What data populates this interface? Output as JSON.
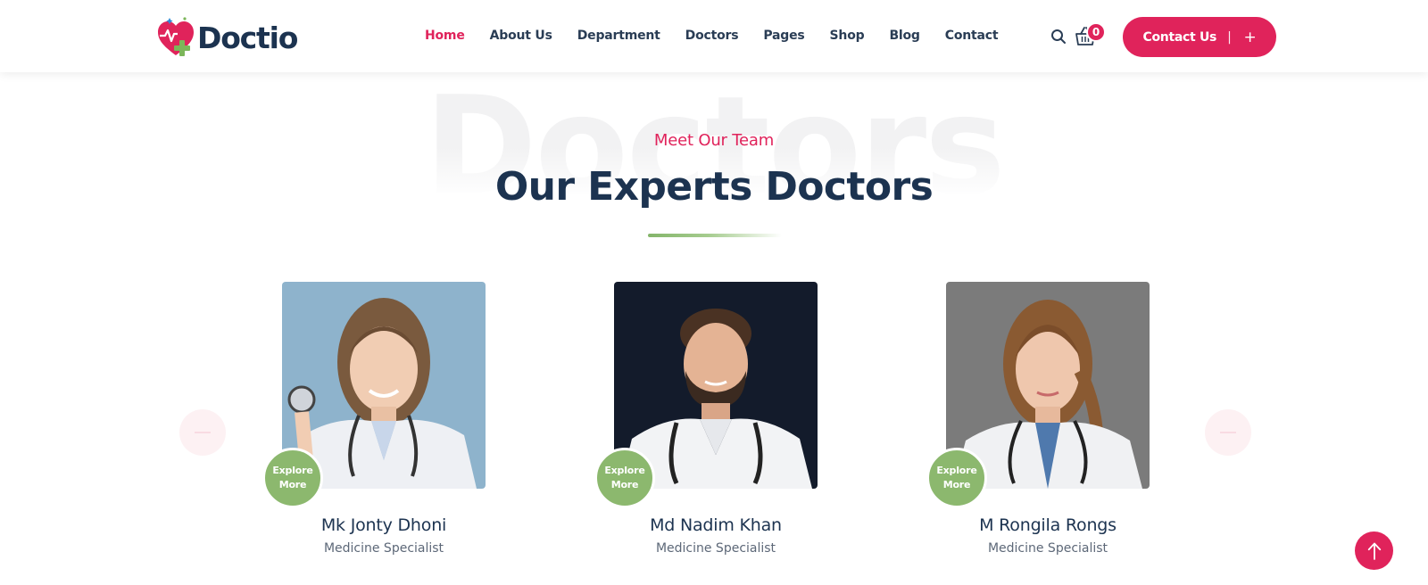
{
  "brand": {
    "name": "Doctio",
    "logo_icon": "heart-cross-icon"
  },
  "nav": {
    "items": [
      {
        "label": "Home",
        "active": true
      },
      {
        "label": "About Us",
        "active": false
      },
      {
        "label": "Department",
        "active": false
      },
      {
        "label": "Doctors",
        "active": false
      },
      {
        "label": "Pages",
        "active": false
      },
      {
        "label": "Shop",
        "active": false
      },
      {
        "label": "Blog",
        "active": false
      },
      {
        "label": "Contact",
        "active": false
      }
    ]
  },
  "header_actions": {
    "search_icon": "search-icon",
    "cart_icon": "basket-icon",
    "cart_count": "0",
    "contact_label": "Contact Us",
    "contact_separator": "|",
    "contact_plus": "+"
  },
  "section": {
    "background_word": "Doctors",
    "subtitle": "Meet Our Team",
    "title": "Our Experts Doctors"
  },
  "slider": {
    "prev_icon": "arrow-left-icon",
    "next_icon": "arrow-right-icon"
  },
  "doctors": [
    {
      "name": "Mk Jonty Dhoni",
      "role": "Medicine Specialist",
      "explore_line1": "Explore",
      "explore_line2": "More"
    },
    {
      "name": "Md Nadim Khan",
      "role": "Medicine Specialist",
      "explore_line1": "Explore",
      "explore_line2": "More"
    },
    {
      "name": "M Rongila Rongs",
      "role": "Medicine Specialist",
      "explore_line1": "Explore",
      "explore_line2": "More"
    }
  ],
  "scroll_top_icon": "arrow-up-icon",
  "colors": {
    "primary": "#e0235b",
    "accent_green": "#8cb86e",
    "heading": "#1c3350",
    "text_muted": "#5d6878"
  }
}
